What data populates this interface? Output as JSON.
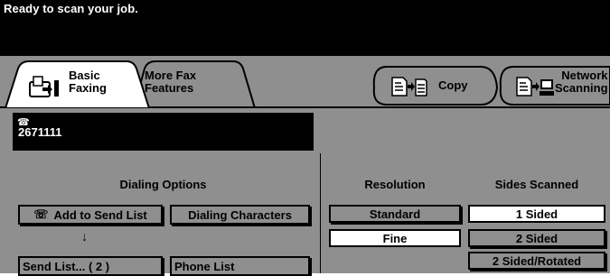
{
  "status": {
    "message": "Ready to scan your job."
  },
  "tabs": {
    "basic": {
      "line1": "Basic",
      "line2": "Faxing"
    },
    "more": {
      "line1": "More Fax",
      "line2": "Features"
    }
  },
  "modes": {
    "copy": {
      "label": "Copy"
    },
    "network": {
      "line1": "Network",
      "line2": "Scanning"
    }
  },
  "phone": {
    "number": "2671111",
    "icon": "telephone-icon"
  },
  "dialing": {
    "title": "Dialing Options",
    "add_to_send_list": "Add to Send List",
    "dialing_characters": "Dialing Characters",
    "arrow": "↓",
    "send_list": "Send List... ( 2 )",
    "phone_list": "Phone List"
  },
  "resolution": {
    "title": "Resolution",
    "options": [
      "Standard",
      "Fine"
    ],
    "selected": "Fine"
  },
  "sides": {
    "title": "Sides Scanned",
    "options": [
      "1 Sided",
      "2 Sided",
      "2 Sided/Rotated"
    ],
    "selected": "1 Sided"
  },
  "colors": {
    "panel_gray": "#8f8f8f",
    "black": "#000000",
    "white": "#ffffff"
  }
}
